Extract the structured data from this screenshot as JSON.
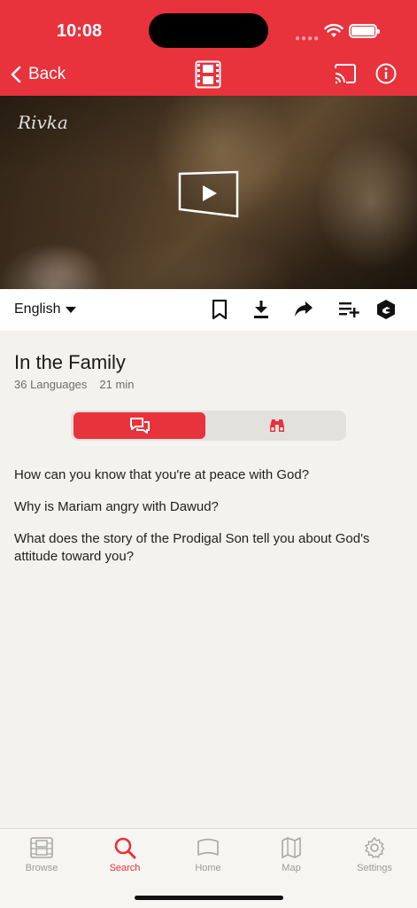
{
  "status": {
    "time": "10:08"
  },
  "nav": {
    "back_label": "Back"
  },
  "video": {
    "watermark": "Rivka"
  },
  "toolbar": {
    "language": "English"
  },
  "content": {
    "title": "In the Family",
    "languages": "36 Languages",
    "duration": "21 min",
    "questions": [
      "How can you know that you're at peace with God?",
      "Why is Mariam angry with Dawud?",
      "What does the story of the Prodigal Son tell you about God's attitude toward you?"
    ]
  },
  "tabs": [
    {
      "label": "Browse",
      "icon": "film-icon"
    },
    {
      "label": "Search",
      "icon": "search-icon",
      "active": true
    },
    {
      "label": "Home",
      "icon": "home-icon"
    },
    {
      "label": "Map",
      "icon": "map-icon"
    },
    {
      "label": "Settings",
      "icon": "gear-icon"
    }
  ],
  "colors": {
    "accent": "#e8323c",
    "background": "#f3f2ee"
  }
}
